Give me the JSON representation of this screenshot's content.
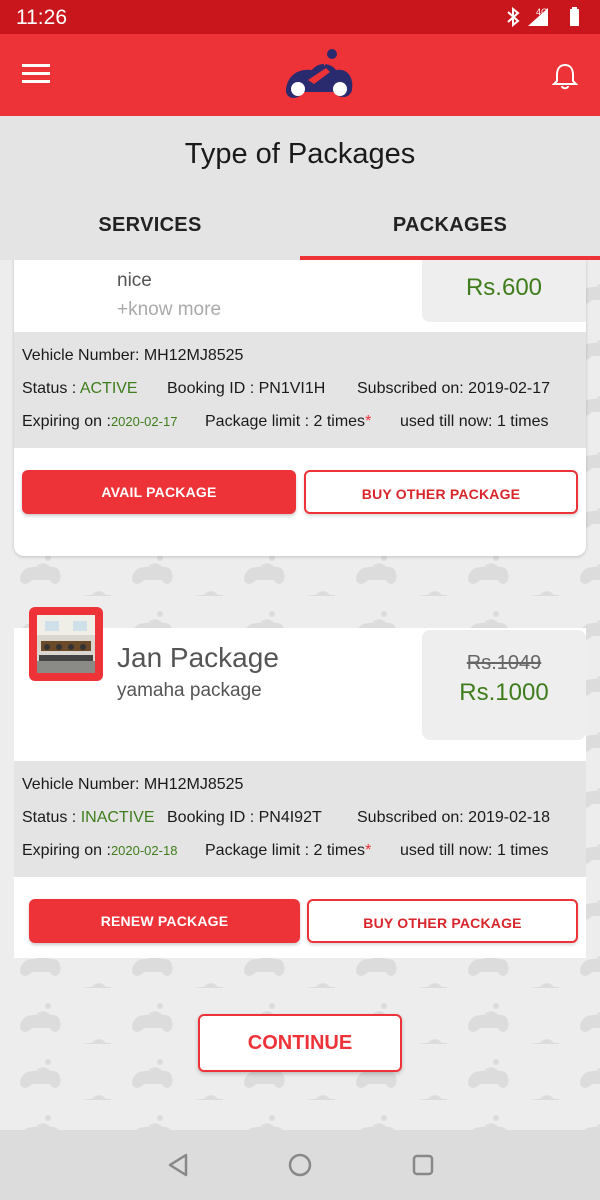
{
  "status_bar": {
    "time": "11:26",
    "network": "4G",
    "icons": [
      "bluetooth-icon",
      "signal-icon",
      "battery-icon"
    ]
  },
  "app_bar": {
    "icons": [
      "menu-icon",
      "app-logo",
      "bell-icon"
    ],
    "color": "#ee3338"
  },
  "page": {
    "title": "Type of Packages"
  },
  "tabs": [
    {
      "label": "SERVICES",
      "active": false
    },
    {
      "label": "PACKAGES",
      "active": true
    }
  ],
  "packages": [
    {
      "description": "nice",
      "know_more": "+know more",
      "price": "Rs.600",
      "vehicle": "Vehicle Number: MH12MJ8525",
      "status_label": "Status : ",
      "status": "ACTIVE",
      "booking": "Booking ID : PN1VI1H",
      "subscribed": "Subscribed on: 2019-02-17",
      "expiring_label": "Expiring on :",
      "expiring": "2020-02-17",
      "limit": "Package limit : 2 times",
      "asterisk": "*",
      "used": "used till now: 1 times",
      "primary_button": "AVAIL PACKAGE",
      "secondary_button": "BUY OTHER PACKAGE"
    },
    {
      "name": "Jan Package",
      "description": "yamaha package",
      "old_price": "Rs.1049",
      "price": "Rs.1000",
      "vehicle": "Vehicle Number: MH12MJ8525",
      "status_label": "Status : ",
      "status": "INACTIVE",
      "booking": "Booking ID : PN4I92T",
      "subscribed": "Subscribed on: 2019-02-18",
      "expiring_label": "Expiring on :",
      "expiring": "2020-02-18",
      "limit": "Package limit : 2 times",
      "asterisk": "*",
      "used": "used till now: 1 times",
      "primary_button": "RENEW PACKAGE",
      "secondary_button": "BUY OTHER PACKAGE"
    }
  ],
  "continue_button": "CONTINUE",
  "nav_bar": {
    "icons": [
      "back-icon",
      "home-icon",
      "recents-icon"
    ]
  }
}
